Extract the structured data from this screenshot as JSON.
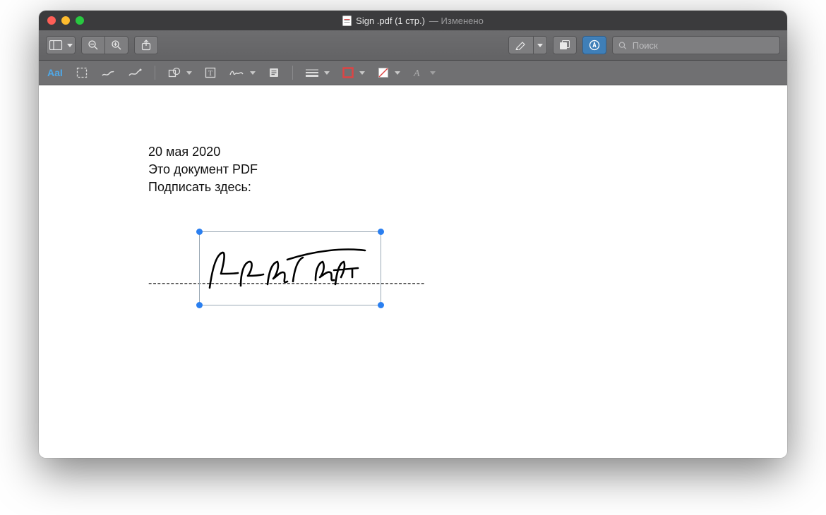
{
  "title": {
    "filename": "Sign .pdf (1 стр.)",
    "status": "— Изменено"
  },
  "search": {
    "placeholder": "Поиск"
  },
  "markup": {
    "text_style_label": "AaI"
  },
  "document": {
    "line1": "20 мая 2020",
    "line2": "Это документ PDF",
    "line3": "Подписать здесь:",
    "dashed_line": "--------------------------------------------------------------"
  }
}
